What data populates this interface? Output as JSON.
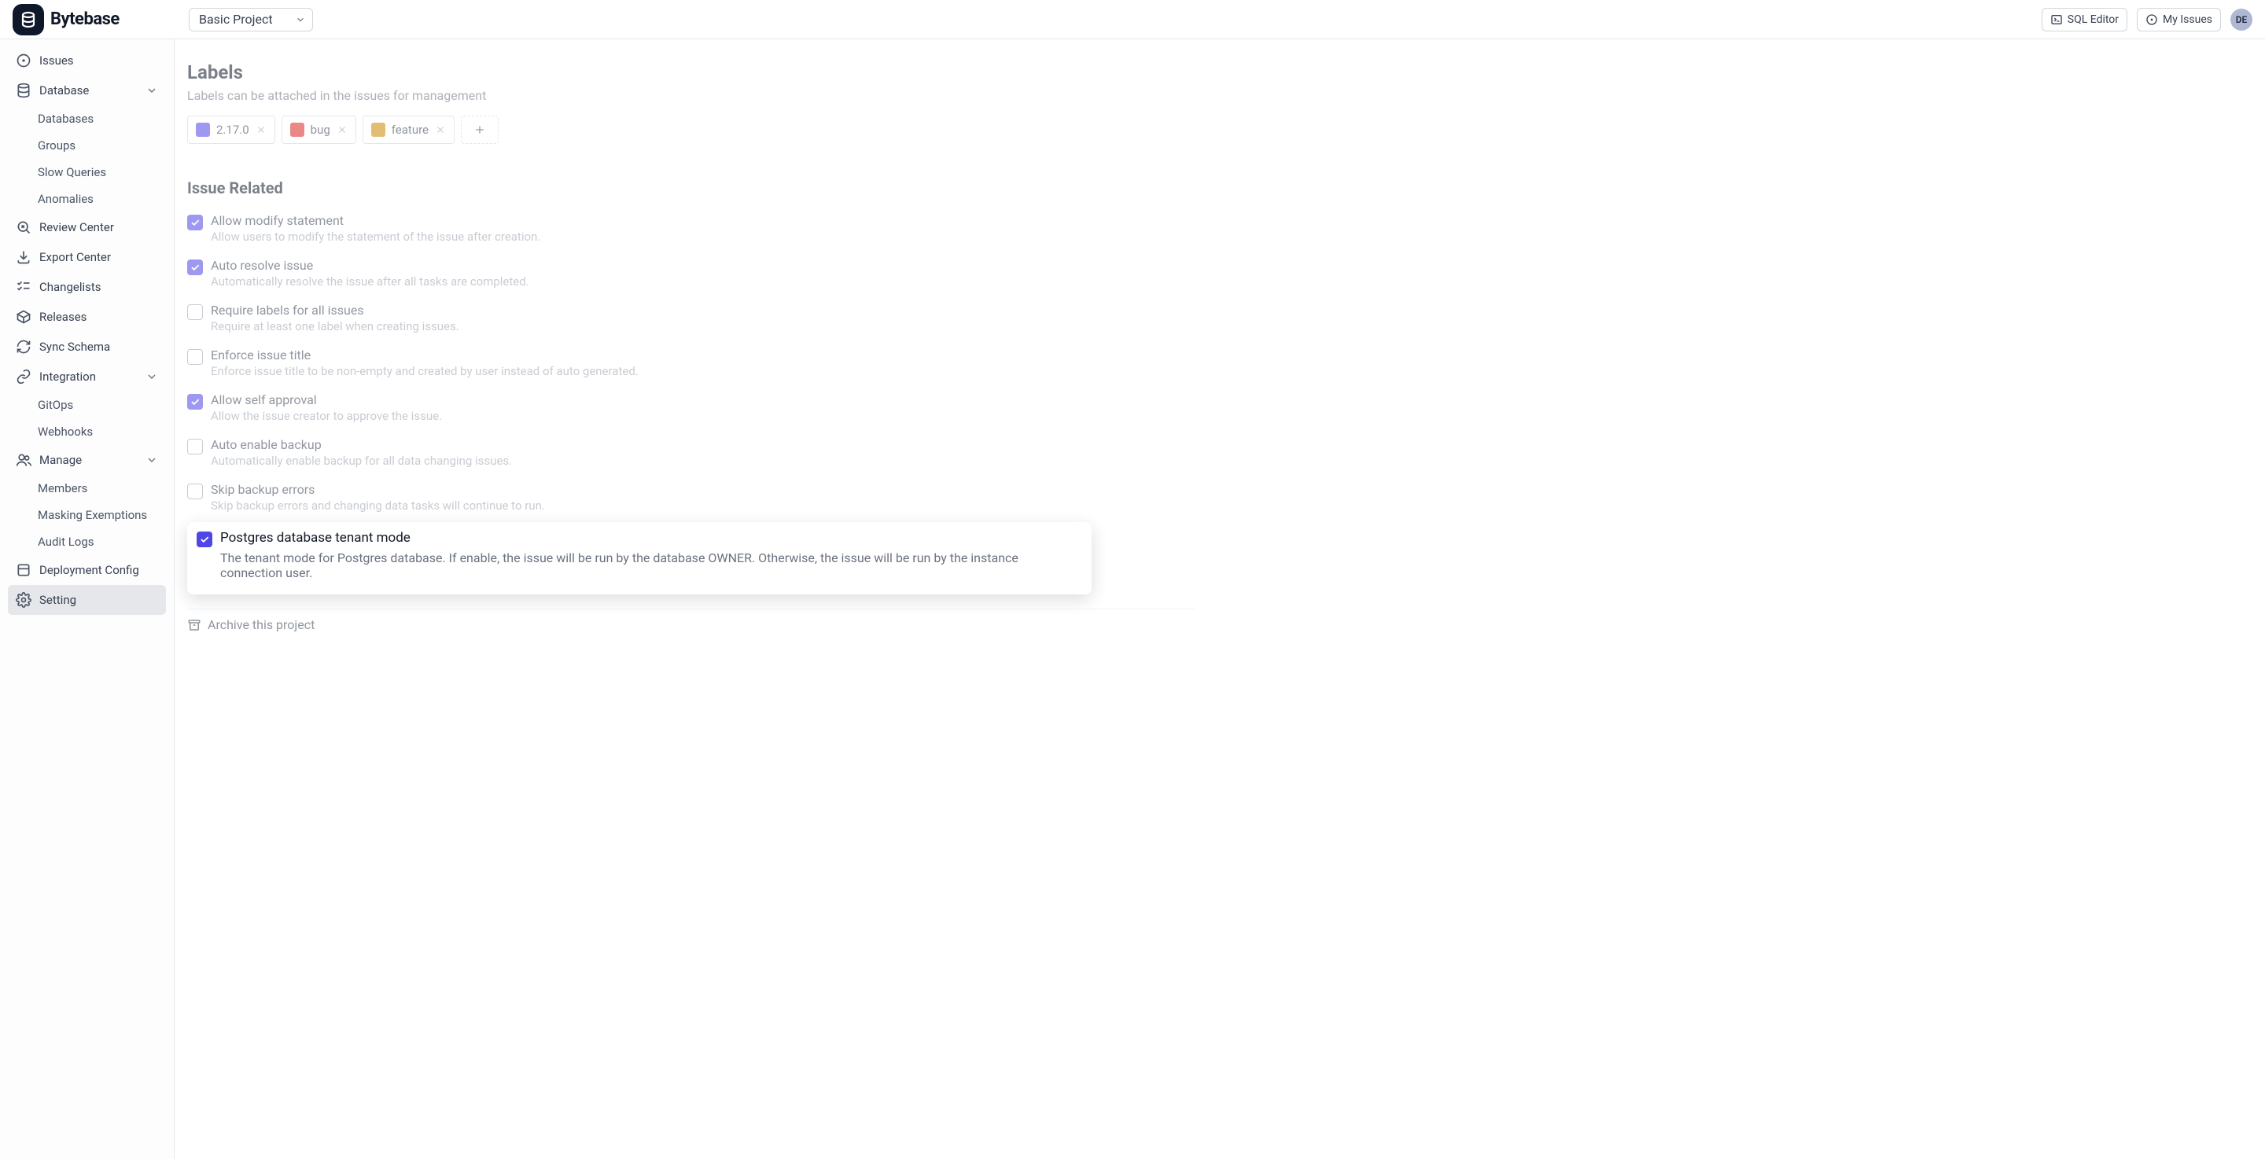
{
  "brand": {
    "name": "Bytebase"
  },
  "header": {
    "project_selected": "Basic Project",
    "sql_editor_label": "SQL Editor",
    "my_issues_label": "My Issues",
    "avatar_initials": "DE"
  },
  "sidebar": {
    "items": [
      {
        "key": "issues",
        "label": "Issues",
        "icon": "circle-dot-icon"
      },
      {
        "key": "database",
        "label": "Database",
        "icon": "database-icon",
        "expandable": true,
        "children": [
          {
            "key": "databases",
            "label": "Databases"
          },
          {
            "key": "groups",
            "label": "Groups"
          },
          {
            "key": "slow-queries",
            "label": "Slow Queries"
          },
          {
            "key": "anomalies",
            "label": "Anomalies"
          }
        ]
      },
      {
        "key": "review-center",
        "label": "Review Center",
        "icon": "search-x-icon"
      },
      {
        "key": "export-center",
        "label": "Export Center",
        "icon": "download-icon"
      },
      {
        "key": "changelists",
        "label": "Changelists",
        "icon": "list-checks-icon"
      },
      {
        "key": "releases",
        "label": "Releases",
        "icon": "package-icon"
      },
      {
        "key": "sync-schema",
        "label": "Sync Schema",
        "icon": "refresh-icon"
      },
      {
        "key": "integration",
        "label": "Integration",
        "icon": "link-icon",
        "expandable": true,
        "children": [
          {
            "key": "gitops",
            "label": "GitOps"
          },
          {
            "key": "webhooks",
            "label": "Webhooks"
          }
        ]
      },
      {
        "key": "manage",
        "label": "Manage",
        "icon": "users-icon",
        "expandable": true,
        "children": [
          {
            "key": "members",
            "label": "Members"
          },
          {
            "key": "masking",
            "label": "Masking Exemptions"
          },
          {
            "key": "audit",
            "label": "Audit Logs"
          }
        ]
      },
      {
        "key": "deployment",
        "label": "Deployment Config",
        "icon": "box-icon"
      },
      {
        "key": "setting",
        "label": "Setting",
        "icon": "gear-icon",
        "active": true
      }
    ]
  },
  "main": {
    "labels": {
      "title": "Labels",
      "subtitle": "Labels can be attached in the issues for management",
      "chips": [
        {
          "text": "2.17.0",
          "color": "#4f46e5"
        },
        {
          "text": "bug",
          "color": "#dc2626"
        },
        {
          "text": "feature",
          "color": "#ca8a04"
        }
      ]
    },
    "issue_related": {
      "title": "Issue Related",
      "settings": [
        {
          "key": "allow-modify",
          "checked": true,
          "title": "Allow modify statement",
          "desc": "Allow users to modify the statement of the issue after creation."
        },
        {
          "key": "auto-resolve",
          "checked": true,
          "title": "Auto resolve issue",
          "desc": "Automatically resolve the issue after all tasks are completed."
        },
        {
          "key": "require-labels",
          "checked": false,
          "title": "Require labels for all issues",
          "desc": "Require at least one label when creating issues."
        },
        {
          "key": "enforce-title",
          "checked": false,
          "title": "Enforce issue title",
          "desc": "Enforce issue title to be non-empty and created by user instead of auto generated."
        },
        {
          "key": "self-approval",
          "checked": true,
          "title": "Allow self approval",
          "desc": "Allow the issue creator to approve the issue."
        },
        {
          "key": "auto-backup",
          "checked": false,
          "title": "Auto enable backup",
          "desc": "Automatically enable backup for all data changing issues."
        },
        {
          "key": "skip-backup",
          "checked": false,
          "title": "Skip backup errors",
          "desc": "Skip backup errors and changing data tasks will continue to run."
        }
      ],
      "highlight": {
        "key": "pg-tenant",
        "checked": true,
        "title": "Postgres database tenant mode",
        "desc": "The tenant mode for Postgres database. If enable, the issue will be run by the database OWNER. Otherwise, the issue will be run by the instance connection user."
      }
    },
    "archive_label": "Archive this project"
  }
}
